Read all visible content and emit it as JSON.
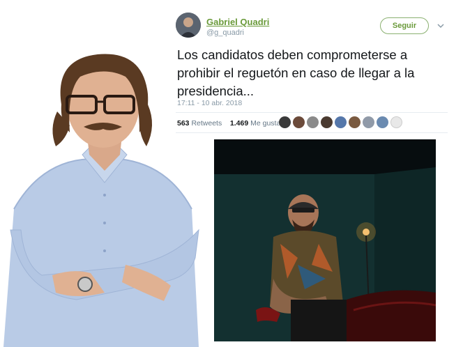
{
  "tweet": {
    "display_name": "Gabriel Quadri",
    "handle": "@g_quadri",
    "follow_label": "Seguir",
    "text": "Los candidatos deben comprometerse a prohibir el reguetón en caso de llegar a la presidencia...",
    "timestamp": "17:11 - 10 abr. 2018",
    "retweets_count": "563",
    "retweets_label": "Retweets",
    "likes_count": "1.469",
    "likes_label": "Me gusta"
  },
  "colors": {
    "accent_green": "#6a9a3a",
    "text": "#14171a",
    "muted": "#8899a6"
  },
  "icons": [
    "chevron-down-icon",
    "avatar",
    "liker-avatar"
  ]
}
